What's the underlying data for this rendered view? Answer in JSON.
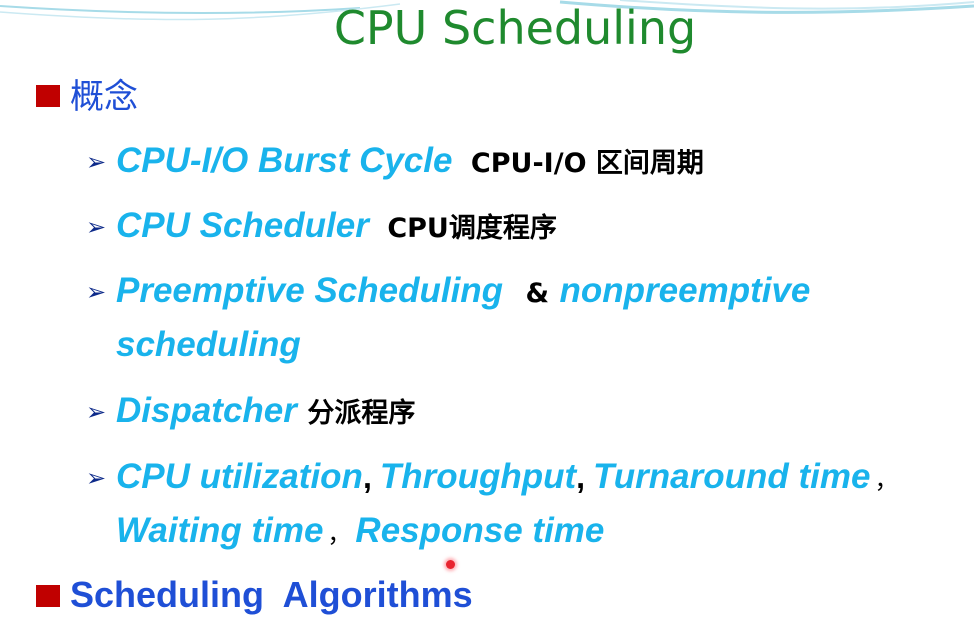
{
  "slide": {
    "title": "CPU Scheduling",
    "colors": {
      "title": "#1f8a2e",
      "bullet_square": "#c00000",
      "level1_text": "#1f4fd6",
      "term_text": "#19b3ec",
      "plain_text": "#000000"
    },
    "bullets": [
      {
        "label": "概念",
        "items": [
          {
            "term": "CPU-I/O Burst Cycle",
            "note": "CPU-I/O 区间周期"
          },
          {
            "term": "CPU Scheduler",
            "note": "CPU调度程序"
          },
          {
            "term_a": "Preemptive Scheduling",
            "joiner": "&",
            "term_b": "nonpreemptive",
            "term_b_cont": "scheduling"
          },
          {
            "term": "Dispatcher",
            "note": "分派程序"
          },
          {
            "terms": [
              "CPU utilization",
              "Throughput",
              "Turnaround time",
              "Waiting time",
              "Response time"
            ],
            "separators": [
              ",",
              ",",
              "，",
              "，"
            ]
          }
        ]
      },
      {
        "label": "Scheduling  Algorithms"
      }
    ],
    "icons": {
      "level1": "square-bullet-icon",
      "level2": "arrow-bullet-icon",
      "pointer": "laser-pointer-icon"
    }
  }
}
